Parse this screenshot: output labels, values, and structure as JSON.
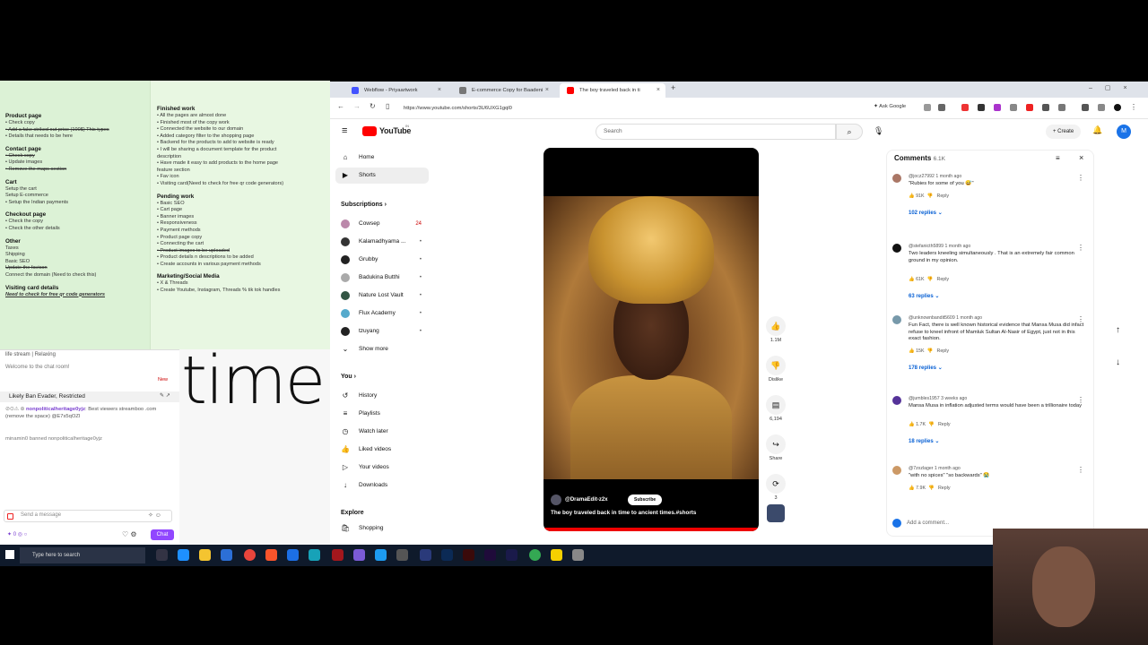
{
  "notes": {
    "left": [
      {
        "h": "Product page"
      },
      {
        "t": "• Check copy",
        "s": 0
      },
      {
        "t": "• Add a fake striked out price (100$) This types",
        "s": 1
      },
      {
        "t": "• Details that needs to be here",
        "s": 0
      },
      {
        "h": "Contact page"
      },
      {
        "t": "• Check copy",
        "s": 1
      },
      {
        "t": "• Update images",
        "s": 0
      },
      {
        "t": "• Remove the maps section",
        "s": 1
      },
      {
        "h": "Cart"
      },
      {
        "t": "Setup the cart",
        "s": 0
      },
      {
        "t": "Setup E-commerce",
        "s": 0
      },
      {
        "t": "• Setup the Indian payments",
        "s": 0
      },
      {
        "h": "Checkout page"
      },
      {
        "t": "• Check the copy",
        "s": 0
      },
      {
        "t": "• Check the other details",
        "s": 0
      },
      {
        "h": "Other"
      },
      {
        "t": "Taxes",
        "s": 0
      },
      {
        "t": "Shipping",
        "s": 0
      },
      {
        "t": "Basic SEO",
        "s": 0
      },
      {
        "t": "Update the favicon",
        "s": 1
      },
      {
        "t": "Connect the domain (Need to check this)",
        "s": 0
      },
      {
        "h": "Visiting card details"
      },
      {
        "t": "Need to check for free qr code generators",
        "u": 1
      }
    ],
    "right": [
      {
        "h": "Finished work"
      },
      {
        "t": "• All the pages are almost done",
        "s": 0
      },
      {
        "t": "• Finished most of the copy work",
        "s": 0
      },
      {
        "t": "• Connected the website to our domain",
        "s": 0
      },
      {
        "t": "• Added category filter to the shopping page",
        "s": 0
      },
      {
        "t": "• Backend for the products to add to website is ready",
        "s": 0
      },
      {
        "t": "• I will be sharing a document template for the product",
        "s": 0
      },
      {
        "t": "description",
        "s": 0
      },
      {
        "t": "• Have made it easy to add products to the home page",
        "s": 0
      },
      {
        "t": "feature section",
        "s": 0
      },
      {
        "t": "• Fav icon",
        "s": 0
      },
      {
        "t": "• Visiting card(Need to check for free qr code generators)",
        "s": 0
      },
      {
        "h": "Pending work"
      },
      {
        "t": "• Basic SEO",
        "s": 0
      },
      {
        "t": "• Cart page",
        "s": 0
      },
      {
        "t": "• Banner images",
        "s": 0
      },
      {
        "t": "• Responsiveness",
        "s": 0
      },
      {
        "t": "• Payment methods",
        "s": 0
      },
      {
        "t": "• Product page copy",
        "s": 0
      },
      {
        "t": "• Connecting the cart",
        "s": 0
      },
      {
        "t": "• Product images to be uploaded",
        "s": 1
      },
      {
        "t": "• Product details n descriptions to be added",
        "s": 0
      },
      {
        "t": "• Create accounts in various payment methods",
        "s": 0
      },
      {
        "h": "Marketing/Social Media"
      },
      {
        "t": "• X & Threads",
        "s": 0
      },
      {
        "t": "• Create Youtube, Instagram, Threads % tik tok handles",
        "s": 0
      }
    ]
  },
  "chat": {
    "title": "life stream | Relaxing",
    "welcome": "Welcome to the chat room!",
    "new_label": "New",
    "pinned_user": "Likely Ban Evader, Restricted",
    "msg_user": "nonpoliticalheritage0yjz",
    "msg_text": "Best viewers streamboo .com (remove the space) @E7s5qOZl",
    "ban_text": "minamin0 banned nonpoliticalheritage0yjz",
    "input_placeholder": "Send a message",
    "points": "0",
    "chat_button": "Chat"
  },
  "overlay_text": "time",
  "browser": {
    "tabs": [
      {
        "label": "Webflow - Priyaartwork",
        "color": "#4353ff"
      },
      {
        "label": "E-commerce Copy for Baadeni",
        "color": "#777"
      },
      {
        "label": "The boy traveled back in ti",
        "color": "#ff0000"
      }
    ],
    "url": "https://www.youtube.com/shorts/3U6UXG1gql0",
    "ask_google": "Ask Google"
  },
  "youtube": {
    "logo": "YouTube",
    "logo_sup": "IN",
    "search_placeholder": "Search",
    "create_label": "Create",
    "account_initial": "M",
    "nav": [
      {
        "label": "Home",
        "icon": "⌂"
      },
      {
        "label": "Shorts",
        "icon": "▶"
      }
    ],
    "subscriptions_heading": "Subscriptions",
    "subscriptions": [
      {
        "label": "Cowsep",
        "badge": "24",
        "color": "#b8a"
      },
      {
        "label": "Kalamadhyama ...",
        "badge": "•",
        "color": "#333"
      },
      {
        "label": "Grubby",
        "badge": "•",
        "color": "#222"
      },
      {
        "label": "Badukina Butthi",
        "badge": "•",
        "color": "#aaa"
      },
      {
        "label": "Nature Lost Vault",
        "badge": "•",
        "color": "#354"
      },
      {
        "label": "Flux Academy",
        "badge": "•",
        "color": "#5ac"
      },
      {
        "label": "tzuyang",
        "badge": "•",
        "color": "#222"
      }
    ],
    "show_more": "Show more",
    "you_heading": "You",
    "you_items": [
      {
        "label": "History",
        "icon": "↺"
      },
      {
        "label": "Playlists",
        "icon": "≡"
      },
      {
        "label": "Watch later",
        "icon": "◷"
      },
      {
        "label": "Liked videos",
        "icon": "👍"
      },
      {
        "label": "Your videos",
        "icon": "▷"
      },
      {
        "label": "Downloads",
        "icon": "↓"
      }
    ],
    "explore_heading": "Explore",
    "explore_items": [
      {
        "label": "Shopping",
        "icon": "🛍"
      }
    ]
  },
  "video": {
    "channel": "@DramaEdit-z2x",
    "subscribe": "Subscribe",
    "title": "The boy traveled back in time to ancient times.#shorts",
    "likes": "1.1M",
    "dislike_label": "Dislike",
    "comments_count": "6,194",
    "share_label": "Share",
    "remix_count": "3"
  },
  "comments": {
    "heading": "Comments",
    "count": "6.1K",
    "add_placeholder": "Add a comment...",
    "items": [
      {
        "user": "@jocz27992",
        "time": "1 month ago",
        "text": "\"Rubies for some of you 😅\"",
        "likes": "91K",
        "replies": "102 replies",
        "color": "#a76"
      },
      {
        "user": "@stefanicth5899",
        "time": "1 month ago",
        "text": "Two leaders kneeling simultaneously . That is an extremely fair common ground in my opinion.",
        "likes": "61K",
        "replies": "63 replies",
        "color": "#111"
      },
      {
        "user": "@unknownbandit5609",
        "time": "1 month ago",
        "text": "Fun Fact, there is well known historical evidence that Mansa Musa did infact refuse to kneel infront of Mamluk Sultan Al-Nasir of Egypt, just not in this exact fashion.",
        "likes": "15K",
        "replies": "178 replies",
        "color": "#79a"
      },
      {
        "user": "@jumbles1957",
        "time": "3 weeks ago",
        "text": "Mansa Musa in inflation adjusted terms would have been a trillionaire today",
        "likes": "1.7K",
        "replies": "18 replies",
        "color": "#539"
      },
      {
        "user": "@7zxzlager",
        "time": "1 month ago",
        "text": "\"with no spices\" \"so backwards\" 😭",
        "likes": "7.9K",
        "replies": "",
        "color": "#c96"
      }
    ],
    "reply_label": "Reply"
  },
  "taskbar": {
    "search_placeholder": "Type here to search"
  }
}
